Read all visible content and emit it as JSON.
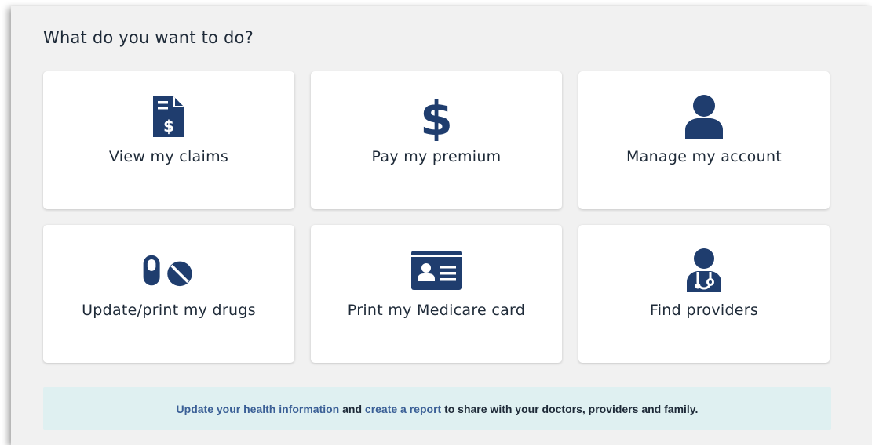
{
  "page": {
    "title": "What do you want to do?"
  },
  "colors": {
    "icon": "#1f3d6e",
    "banner_bg": "#dff0f1",
    "link": "#3a5f96"
  },
  "cards": [
    {
      "label": "View my claims",
      "icon": "claims-document-icon"
    },
    {
      "label": "Pay my premium",
      "icon": "dollar-sign-icon"
    },
    {
      "label": "Manage my account",
      "icon": "person-icon"
    },
    {
      "label": "Update/print my drugs",
      "icon": "pill-icon"
    },
    {
      "label": "Print my Medicare card",
      "icon": "id-card-icon"
    },
    {
      "label": "Find providers",
      "icon": "doctor-icon"
    }
  ],
  "banner": {
    "link1": "Update your health information",
    "text1": " and ",
    "link2": "create a report",
    "text2": " to share with your doctors, providers and family."
  }
}
